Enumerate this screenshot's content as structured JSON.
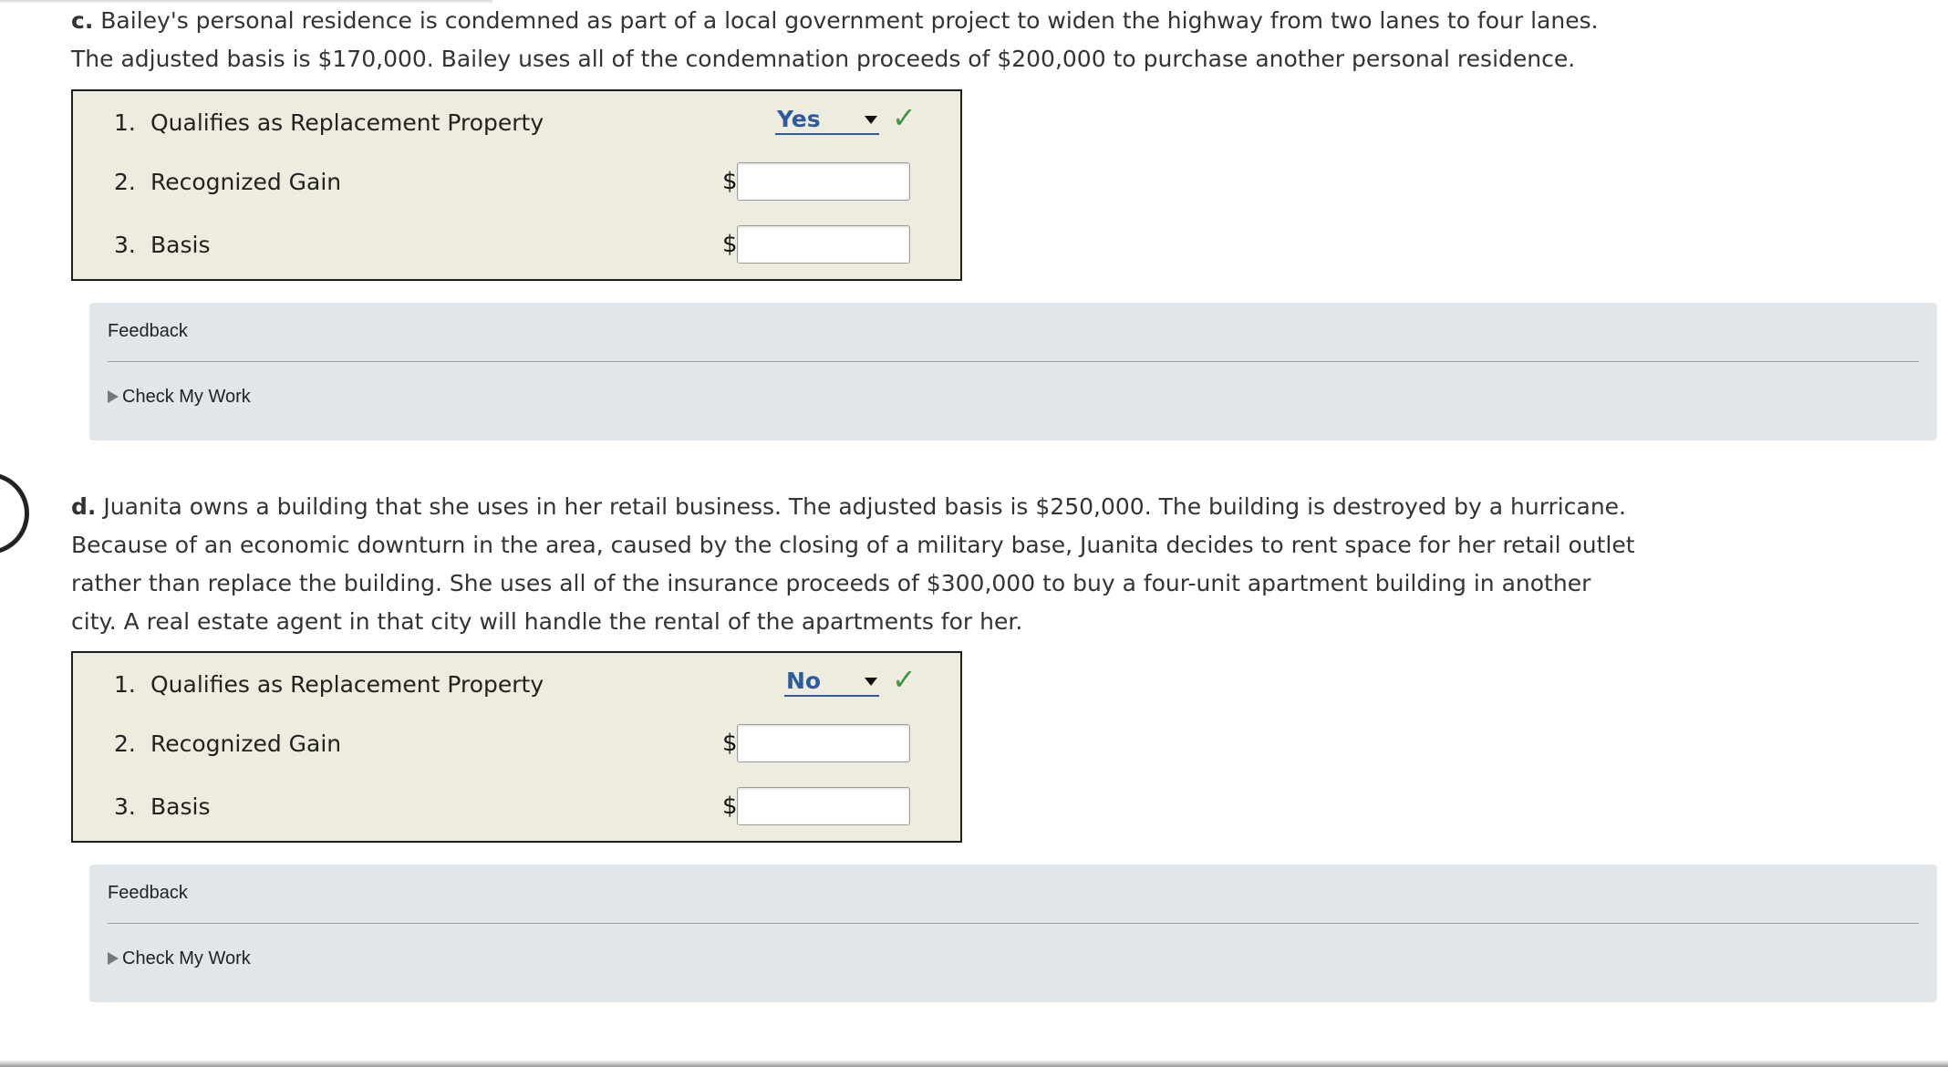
{
  "part_c": {
    "letter": "c.",
    "text": "Bailey's personal residence is condemned as part of a local government project to widen the highway from two lanes to four lanes. The adjusted basis is $170,000. Bailey uses all of the condemnation proceeds of $200,000 to purchase another personal residence.",
    "rows": [
      {
        "num": "1.",
        "label": "Qualifies as Replacement Property",
        "selected": "Yes"
      },
      {
        "num": "2.",
        "label": "Recognized Gain",
        "currency": "$",
        "value": ""
      },
      {
        "num": "3.",
        "label": "Basis",
        "currency": "$",
        "value": ""
      }
    ],
    "feedback": {
      "title": "Feedback",
      "check_label": "Check My Work"
    }
  },
  "part_d": {
    "letter": "d.",
    "text": "Juanita owns a building that she uses in her retail business. The adjusted basis is $250,000. The building is destroyed by a hurricane. Because of an economic downturn in the area, caused by the closing of a military base, Juanita decides to rent space for her retail outlet rather than replace the building. She uses all of the insurance proceeds of $300,000 to buy a four-unit apartment building in another city. A real estate agent in that city will handle the rental of the apartments for her.",
    "rows": [
      {
        "num": "1.",
        "label": "Qualifies as Replacement Property",
        "selected": "No"
      },
      {
        "num": "2.",
        "label": "Recognized Gain",
        "currency": "$",
        "value": ""
      },
      {
        "num": "3.",
        "label": "Basis",
        "currency": "$",
        "value": ""
      }
    ],
    "feedback": {
      "title": "Feedback",
      "check_label": "Check My Work"
    }
  },
  "icons": {
    "check": "checkmark-icon",
    "caret": "caret-down-icon",
    "expand": "triangle-right-icon"
  },
  "colors": {
    "box_bg": "#eeebdf",
    "feedback_bg": "#e1e6ea",
    "link_blue": "#2e5a9e",
    "check_green": "#3a9a3a"
  }
}
